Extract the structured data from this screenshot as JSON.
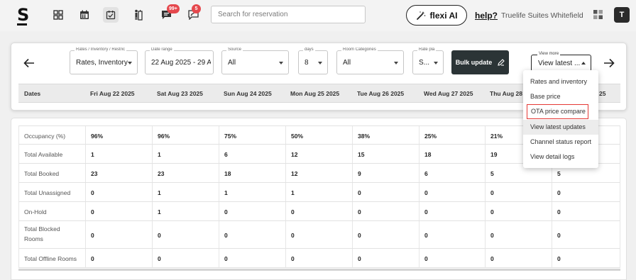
{
  "app": {
    "logo": "S"
  },
  "nav": {
    "badges": {
      "messages": "99+",
      "tasks": "5"
    }
  },
  "search": {
    "placeholder": "Search for reservation"
  },
  "flexi": {
    "label": "flexi AI"
  },
  "help": {
    "label": "help?"
  },
  "property": {
    "name": "Truelife Suites Whitefield"
  },
  "user": {
    "initial": "T"
  },
  "filters": {
    "rates": {
      "label": "Rates / Inventory / Restric",
      "value": "Rates, Inventory"
    },
    "date_range": {
      "label": "Date range",
      "value": "22 Aug 2025 - 29 A"
    },
    "source": {
      "label": "Source",
      "value": "All"
    },
    "days": {
      "label": "days",
      "value": "8"
    },
    "room_categories": {
      "label": "Room Categories",
      "value": "All"
    },
    "rate_plan": {
      "label": "Rate pla",
      "value": "S..."
    },
    "bulk_update": "Bulk update",
    "view_more": {
      "label": "View more",
      "value": "View latest ..."
    }
  },
  "dates_header": {
    "label": "Dates",
    "dates": [
      "Fri Aug 22 2025",
      "Sat Aug 23 2025",
      "Sun Aug 24 2025",
      "Mon Aug 25 2025",
      "Tue Aug 26 2025",
      "Wed Aug 27 2025",
      "Thu Aug 28",
      "25"
    ]
  },
  "menu": {
    "items": [
      "Rates and inventory",
      "Base price",
      "OTA price compare",
      "View latest updates",
      "Channel status report",
      "View detail logs"
    ]
  },
  "table": {
    "rows": [
      {
        "label": "Occupancy (%)",
        "values": [
          "96%",
          "96%",
          "75%",
          "50%",
          "38%",
          "25%",
          "21%",
          ""
        ]
      },
      {
        "label": "Total Available",
        "values": [
          "1",
          "1",
          "6",
          "12",
          "15",
          "18",
          "19",
          ""
        ]
      },
      {
        "label": "Total Booked",
        "values": [
          "23",
          "23",
          "18",
          "12",
          "9",
          "6",
          "5",
          "5"
        ]
      },
      {
        "label": "Total Unassigned",
        "values": [
          "0",
          "1",
          "1",
          "1",
          "0",
          "0",
          "0",
          "0"
        ]
      },
      {
        "label": "On-Hold",
        "values": [
          "0",
          "1",
          "0",
          "0",
          "0",
          "0",
          "0",
          "0"
        ]
      },
      {
        "label": "Total Blocked Rooms",
        "values": [
          "0",
          "0",
          "0",
          "0",
          "0",
          "0",
          "0",
          "0"
        ]
      },
      {
        "label": "Total Offline Rooms",
        "values": [
          "0",
          "0",
          "0",
          "0",
          "0",
          "0",
          "0",
          "0"
        ]
      }
    ]
  }
}
